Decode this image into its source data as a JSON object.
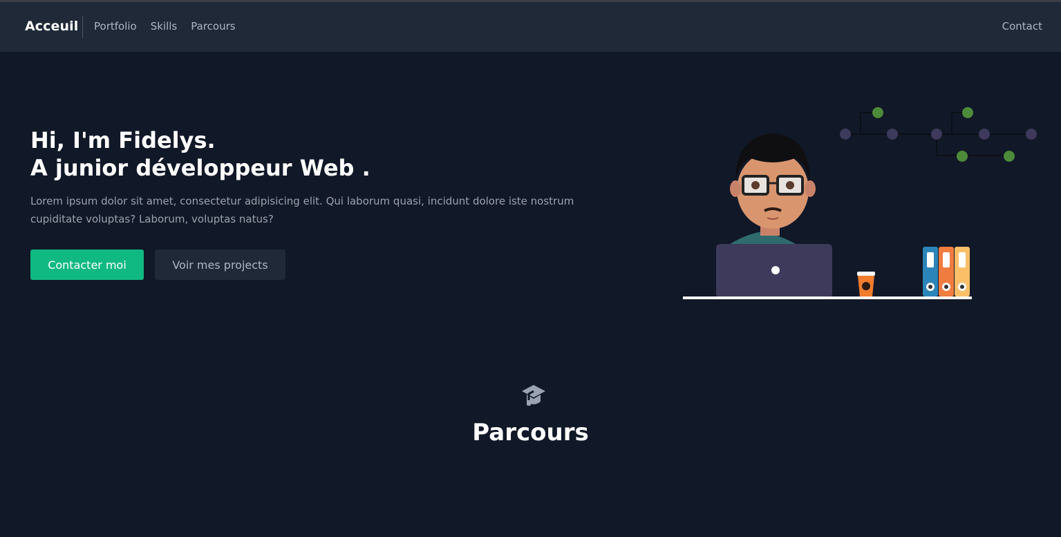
{
  "nav": {
    "brand": "Acceuil",
    "links": [
      "Portfolio",
      "Skills",
      "Parcours"
    ],
    "contact": "Contact"
  },
  "hero": {
    "title_line1": "Hi, I'm Fidelys.",
    "title_line2": "A junior développeur Web .",
    "text": "Lorem ipsum dolor sit amet, consectetur adipisicing elit. Qui laborum quasi, incidunt dolore iste nostrum cupiditate voluptas? Laborum, voluptas natus?",
    "primary_button": "Contacter moi",
    "secondary_button": "Voir mes projects"
  },
  "section": {
    "icon": "graduation-cap-icon",
    "title": "Parcours"
  },
  "colors": {
    "background": "#111827",
    "navbar": "#1f2937",
    "accent": "#10b981"
  }
}
